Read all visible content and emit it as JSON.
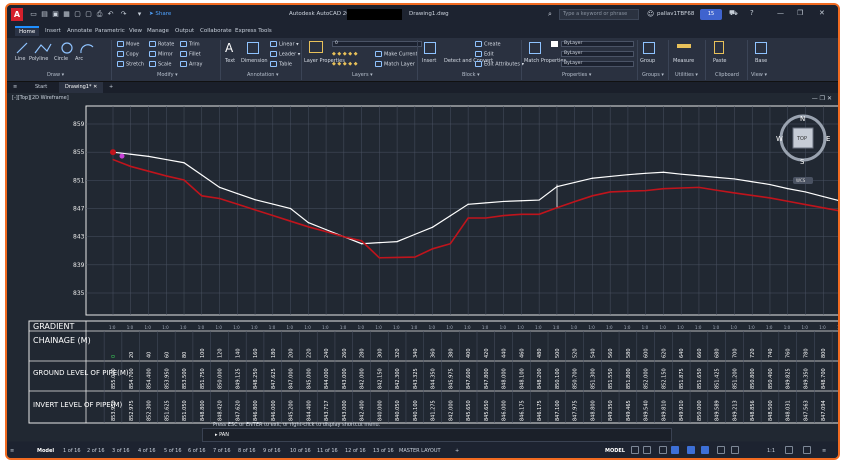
{
  "titlebar": {
    "app_letter": "A",
    "share": "Share",
    "title": "Autodesk AutoCAD 2026",
    "file": "Drawing1.dwg",
    "search_placeholder": "Type a keyword or phrase",
    "user": "pallav1TBF68",
    "timer": "15"
  },
  "menu": [
    "Home",
    "Insert",
    "Annotate",
    "Parametric",
    "View",
    "Manage",
    "Output",
    "Collaborate",
    "Express Tools"
  ],
  "ribbon": {
    "draw": {
      "line": "Line",
      "polyline": "Polyline",
      "circle": "Circle",
      "arc": "Arc",
      "label": "Draw"
    },
    "modify": {
      "move": "Move",
      "rotate": "Rotate",
      "trim": "Trim",
      "copy": "Copy",
      "mirror": "Mirror",
      "fillet": "Fillet",
      "stretch": "Stretch",
      "scale": "Scale",
      "array": "Array",
      "label": "Modify"
    },
    "annotation": {
      "text": "Text",
      "dimension": "Dimension",
      "linear": "Linear",
      "leader": "Leader",
      "table": "Table",
      "label": "Annotation"
    },
    "layers": {
      "properties": "Layer Properties",
      "current": "0",
      "make_current": "Make Current",
      "match_layer": "Match Layer",
      "label": "Layers"
    },
    "block": {
      "insert": "Insert",
      "create": "Create",
      "edit": "Edit",
      "edit_attr": "Edit Attributes",
      "detect": "Detect and Convert",
      "label": "Block"
    },
    "properties": {
      "match": "Match Properties",
      "bylayer1": "ByLayer",
      "bylayer2": "ByLayer",
      "bylayer3": "ByLayer",
      "label": "Properties"
    },
    "groups": {
      "group": "Group",
      "label": "Groups"
    },
    "utilities": {
      "measure": "Measure",
      "label": "Utilities"
    },
    "clipboard": {
      "paste": "Paste",
      "label": "Clipboard"
    },
    "view": {
      "base": "Base",
      "label": "View"
    }
  },
  "doctabs": {
    "start": "Start",
    "drawing": "Drawing1*"
  },
  "viewport": {
    "label": "[-][Top][2D Wireframe]"
  },
  "viewcube": {
    "n": "N",
    "s": "S",
    "e": "E",
    "w": "W",
    "top": "TOP",
    "wcs": "WCS"
  },
  "chart_data": {
    "type": "line",
    "y_ticks": [
      "859",
      "855",
      "851",
      "847",
      "843",
      "839",
      "835"
    ],
    "ylim": [
      835,
      859
    ],
    "chainage": [
      "0",
      "20",
      "40",
      "60",
      "80",
      "100",
      "120",
      "140",
      "160",
      "180",
      "200",
      "220",
      "240",
      "260",
      "280",
      "300",
      "320",
      "340",
      "360",
      "380",
      "400",
      "420",
      "440",
      "460",
      "480",
      "500",
      "520",
      "540",
      "560",
      "580",
      "600",
      "620",
      "640",
      "660",
      "680",
      "700",
      "720",
      "740",
      "760",
      "780",
      "800",
      "820"
    ],
    "ground_level": [
      "855.000",
      "854.700",
      "854.400",
      "853.950",
      "853.500",
      "851.750",
      "850.000",
      "849.125",
      "848.250",
      "847.625",
      "847.000",
      "845.000",
      "844.000",
      "843.000",
      "842.000",
      "842.150",
      "842.300",
      "843.325",
      "844.350",
      "845.975",
      "847.600",
      "847.800",
      "848.000",
      "848.100",
      "848.200",
      "850.100",
      "850.700",
      "851.300",
      "851.550",
      "851.800",
      "852.000",
      "852.150",
      "851.875",
      "851.650",
      "851.425",
      "851.200",
      "850.800",
      "850.400",
      "849.825",
      "849.350",
      "848.700",
      "848.050"
    ],
    "invert_level": [
      "853.950",
      "852.975",
      "852.300",
      "851.625",
      "851.050",
      "848.800",
      "848.420",
      "847.620",
      "846.800",
      "846.000",
      "845.200",
      "844.400",
      "843.717",
      "843.000",
      "842.400",
      "840.000",
      "840.050",
      "840.100",
      "841.275",
      "842.000",
      "845.650",
      "845.650",
      "846.000",
      "846.175",
      "846.175",
      "847.100",
      "847.975",
      "848.800",
      "849.350",
      "849.465",
      "849.540",
      "849.810",
      "849.910",
      "850.000",
      "849.589",
      "849.213",
      "848.856",
      "848.500",
      "848.031",
      "847.563",
      "847.094",
      "846.625"
    ],
    "gradient": [
      "1:0",
      "1:0",
      "1:0",
      "1:0",
      "1:0",
      "1:0",
      "1:0",
      "1:0",
      "1:0",
      "1:0",
      "1:0",
      "1:0",
      "1:0",
      "1:0",
      "1:0",
      "1:0",
      "1:0",
      "1:0",
      "1:0",
      "1:0",
      "1:0",
      "1:0",
      "1:0",
      "1:0",
      "1:0",
      "1:0",
      "1:0",
      "1:0",
      "1:0",
      "1:0",
      "1:0",
      "1:0",
      "1:0",
      "1:0",
      "1:0",
      "1:0",
      "1:0",
      "1:0",
      "1:0",
      "1:0",
      "1:0",
      "1:0"
    ],
    "row_labels": {
      "gradient": "GRADIENT",
      "chainage": "CHAINAGE (M)",
      "ground": "GROUND LEVEL OF PIPE(M)",
      "invert": "INVERT LEVEL OF PIPE(M)"
    },
    "series": [
      {
        "color": "#ffffff"
      },
      {
        "color": "#c0141c"
      }
    ]
  },
  "cmd": {
    "history": "Press ESC or ENTER to exit, or right-click to display shortcut menu.",
    "input": "PAN",
    "tag": "Command:"
  },
  "statusbar": {
    "tabs": [
      "Model",
      "1 of 16",
      "2 of 16",
      "3 of 16",
      "4 of 16",
      "5 of 16",
      "6 of 16",
      "7 of 16",
      "8 of 16",
      "9 of 16",
      "10 of 16",
      "11 of 16",
      "12 of 16",
      "13 of 16",
      "MASTER LAYOUT"
    ],
    "model": "MODEL",
    "scale": "1:1"
  }
}
